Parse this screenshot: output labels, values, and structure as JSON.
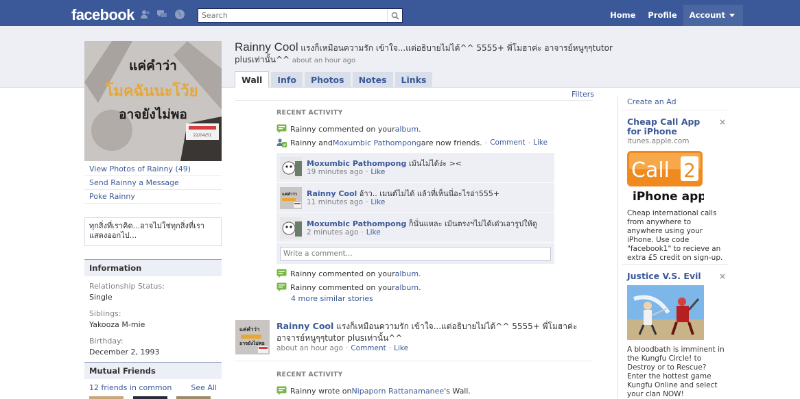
{
  "topbar": {
    "logo": "facebook",
    "search_placeholder": "Search",
    "nav": [
      "Home",
      "Profile",
      "Account"
    ]
  },
  "profile": {
    "name": "Rainny Cool",
    "status": "แรงก็เหมือนความรัก เข้าใจ...แต่อธิบายไม่ได้^^ 5555+ พี่โมฮาค่ะ อาจารย์หนูๆๆtutor plusเท่านั้น^^",
    "status_time": "about an hour ago",
    "picture_text": [
      "แค่คำว่า",
      "โมคฉันนะโว้ย",
      "อาจยังไม่พอ"
    ]
  },
  "tabs": [
    "Wall",
    "Info",
    "Photos",
    "Notes",
    "Links"
  ],
  "filters": "Filters",
  "left_links": [
    "View Photos of Rainny (49)",
    "Send Rainny a Message",
    "Poke Rainny"
  ],
  "bio": "ทุกสิ่งที่เราคิด...อาจไม่ใช่ทุกสิ่งที่เราแสดงออกไป...",
  "information": {
    "header": "Information",
    "relationship_label": "Relationship Status:",
    "relationship_value": "Single",
    "siblings_label": "Siblings:",
    "siblings_value": "Yakooza M-mie",
    "birthday_label": "Birthday:",
    "birthday_value": "December 2, 1993"
  },
  "mutual": {
    "header": "Mutual Friends",
    "count_text": "12 friends in common",
    "see_all": "See All"
  },
  "feed": {
    "recent_activity": "RECENT ACTIVITY",
    "act1": {
      "prefix": "Rainny commented on your ",
      "link": "album",
      "suffix": "."
    },
    "act2": {
      "prefix": "Rainny and ",
      "link": "Moxumbic Pathompong",
      "suffix": " are now friends.",
      "comment": "Comment",
      "like": "Like"
    },
    "comments": [
      {
        "author": "Moxumbic Pathompong",
        "text": " เม้นไม่ได้ง่ะ ><",
        "time": "19 minutes ago",
        "like": "Like"
      },
      {
        "author": "Rainny Cool",
        "text": " อ้าว.. เมนต์ไม่ได้ แล้วที่เห็นนี่อะไรอ่า555+",
        "time": "11 minutes ago",
        "like": "Like"
      },
      {
        "author": "Moxumbic Pathompong",
        "text": " ก็นั่นแหละ เม้นตรงฯไม่ได้เด๋วเอารูปให้ดู",
        "time": "2 minutes ago",
        "like": "Like"
      }
    ],
    "write_comment": "Write a comment...",
    "act3": {
      "prefix": "Rainny commented on your ",
      "link": "album",
      "suffix": "."
    },
    "act4": {
      "prefix": "Rainny commented on your ",
      "link": "album",
      "suffix": "."
    },
    "more_stories": "4 more similar stories",
    "story": {
      "author": "Rainny Cool",
      "text": " แรงก็เหมือนความรัก เข้าใจ...แต่อธิบายไม่ได้^^ 5555+ พี่โมฮาค่ะ อาจารย์หนูๆๆtutor plusเท่านั้น^^",
      "time": "about an hour ago",
      "comment": "Comment",
      "like": "Like"
    },
    "recent_activity2": "RECENT ACTIVITY",
    "act5": {
      "prefix": "Rainny wrote on ",
      "link": "Nipaporn Rattanamanee",
      "suffix": "'s Wall."
    }
  },
  "ads": {
    "create_ad": "Create an Ad",
    "ad1": {
      "title": "Cheap Call App for iPhone",
      "url": "itunes.apple.com",
      "image_text": "Call",
      "image_number": "2",
      "image_caption": "iPhone app",
      "body": "Cheap international calls from anywhere to anywhere using your iPhone. Use code \"facebook1\" to recieve an extra £5 credit on sign-up."
    },
    "ad2": {
      "title": "Justice V.S. Evil",
      "body": "A bloodbath is imminent in the Kungfu Circle! to Destroy or to Rescue? Enter the hottest game Kungfu Online and select your clan NOW!"
    },
    "close": "×"
  },
  "colors": {
    "brand": "#3b5998",
    "band": "#edeff4",
    "tab": "#d8dfea"
  }
}
